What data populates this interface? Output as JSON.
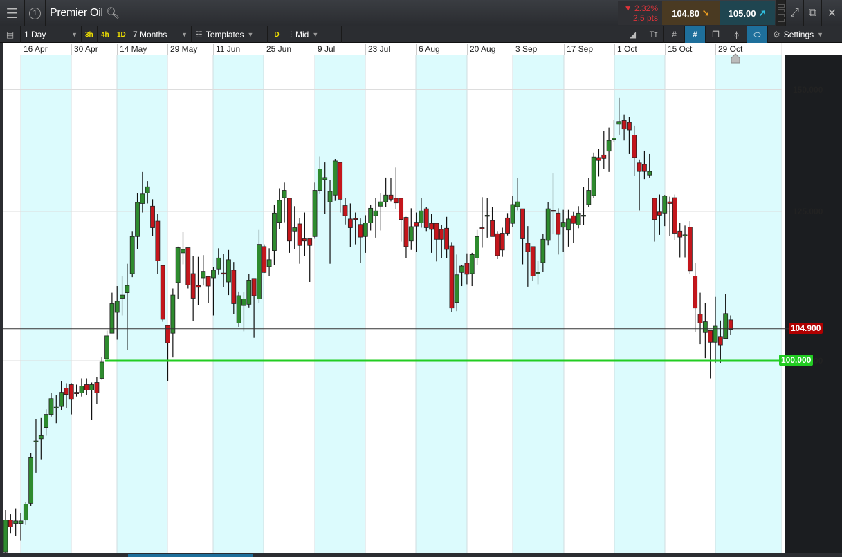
{
  "header": {
    "title": "Premier Oil",
    "window_number": "1",
    "change_pct": "2.32%",
    "change_pts": "2.5 pts",
    "sell": "104.80",
    "buy": "105.00"
  },
  "toolbar": {
    "interval": "1 Day",
    "quick": [
      "3h",
      "4h",
      "1D"
    ],
    "range": "7 Months",
    "templates": "Templates",
    "d_label": "D",
    "price_type": "Mid",
    "settings": "Settings"
  },
  "colors": {
    "up": "#2e8b2e",
    "down": "#c4161c",
    "band": "#dcfbfd",
    "level": "#22cc22",
    "last": "#b00000"
  },
  "chart_data": {
    "type": "candlestick",
    "scale": "log",
    "ylim": [
      75,
      158
    ],
    "x_ticks": [
      "16 Apr",
      "30 Apr",
      "14 May",
      "29 May",
      "11 Jun",
      "25 Jun",
      "9 Jul",
      "23 Jul",
      "6 Aug",
      "20 Aug",
      "3 Sep",
      "17 Sep",
      "1 Oct",
      "15 Oct",
      "29 Oct"
    ],
    "y_ticks": [
      "150.000",
      "125.000",
      "100.000"
    ],
    "last_price": "104.900",
    "level_line": "100.000",
    "ohlc": [
      [
        75.1,
        80,
        75,
        78.8
      ],
      [
        78.8,
        79.5,
        77.3,
        78.0
      ],
      [
        78.4,
        80.2,
        77,
        78.7
      ],
      [
        78.4,
        79.6,
        76.4,
        78.7
      ],
      [
        78.8,
        81,
        78.3,
        80.7
      ],
      [
        80.8,
        87.1,
        80.5,
        86.5
      ],
      [
        88.7,
        91.6,
        84.6,
        88.7
      ],
      [
        89,
        91.8,
        86.3,
        89.4
      ],
      [
        90.5,
        93,
        89.4,
        92.3
      ],
      [
        92.3,
        95.3,
        92,
        94.5
      ],
      [
        93.3,
        95,
        91.1,
        93.3
      ],
      [
        93.4,
        97,
        92.9,
        95.4
      ],
      [
        96,
        96.7,
        93.2,
        95.1
      ],
      [
        96.5,
        96.7,
        92.3,
        94.4
      ],
      [
        95.4,
        96.5,
        94.8,
        95.2
      ],
      [
        95.3,
        97.4,
        94.8,
        96.3
      ],
      [
        96.5,
        97.4,
        95,
        95.7
      ],
      [
        95.7,
        96.8,
        91.5,
        96.5
      ],
      [
        96.8,
        97.6,
        93.7,
        95.3
      ],
      [
        97.4,
        100.6,
        97.2,
        99.8
      ],
      [
        100.3,
        104.6,
        100,
        103.8
      ],
      [
        104.2,
        110.7,
        104.4,
        108.9
      ],
      [
        107.5,
        111.8,
        103.2,
        109.3
      ],
      [
        109.8,
        113.5,
        107,
        110.3
      ],
      [
        110.7,
        115.6,
        101.6,
        111.9
      ],
      [
        113.9,
        121.4,
        113.3,
        120.4
      ],
      [
        120.4,
        128.4,
        118.2,
        126.7
      ],
      [
        126.5,
        132.6,
        124.8,
        128.3
      ],
      [
        128.5,
        130.8,
        126.5,
        129.7
      ],
      [
        126,
        127.3,
        120.5,
        122
      ],
      [
        123.2,
        124.6,
        113.9,
        116.1
      ],
      [
        115.3,
        115.3,
        106,
        106.4
      ],
      [
        105.4,
        105.4,
        97,
        102.7
      ],
      [
        104.2,
        111.4,
        100.5,
        110.3
      ],
      [
        112.4,
        118.6,
        109.7,
        118.4
      ],
      [
        117.5,
        121.3,
        115.5,
        118.1
      ],
      [
        118.4,
        118.4,
        111.4,
        112
      ],
      [
        113.9,
        117,
        106.1,
        109.8
      ],
      [
        111.9,
        116.8,
        108.7,
        111.6
      ],
      [
        113.2,
        117.1,
        111.9,
        114.3
      ],
      [
        113.4,
        113.5,
        109,
        111.8
      ],
      [
        113.2,
        115,
        107,
        114.5
      ],
      [
        114.7,
        118.3,
        113.7,
        116.6
      ],
      [
        114,
        117.3,
        111.6,
        113.9
      ],
      [
        112.5,
        118,
        110.3,
        116.3
      ],
      [
        114.5,
        115.9,
        107.2,
        108.9
      ],
      [
        105.8,
        110.9,
        105.2,
        110.2
      ],
      [
        108.6,
        110.8,
        104.5,
        109.7
      ],
      [
        108.8,
        113.8,
        108.3,
        112.8
      ],
      [
        113.1,
        113.1,
        103.5,
        110.2
      ],
      [
        109.7,
        121.6,
        109,
        119
      ],
      [
        118.6,
        119,
        114,
        114.1
      ],
      [
        115.1,
        118.3,
        113.5,
        116.3
      ],
      [
        117.9,
        126.3,
        115.4,
        124.7
      ],
      [
        123,
        129.4,
        121.8,
        127.1
      ],
      [
        127.6,
        130.5,
        123,
        129
      ],
      [
        127.5,
        127.6,
        117.5,
        119.6
      ],
      [
        121.4,
        126,
        118.2,
        122
      ],
      [
        122.7,
        123.8,
        115.6,
        118.8
      ],
      [
        120,
        124.8,
        117,
        119.6
      ],
      [
        120,
        120,
        112.5,
        118.8
      ],
      [
        120.4,
        130.5,
        120,
        129
      ],
      [
        129,
        135.7,
        128.3,
        133.2
      ],
      [
        131.1,
        134.5,
        124.5,
        131.5
      ],
      [
        126.8,
        131,
        115.6,
        128.8
      ],
      [
        128.1,
        135.2,
        127,
        134.8
      ],
      [
        134.5,
        134.5,
        124.8,
        127.3
      ],
      [
        126.1,
        127.5,
        122.6,
        124.2
      ],
      [
        123.6,
        126.5,
        118.5,
        122
      ],
      [
        123.7,
        124.8,
        119,
        123.5
      ],
      [
        122.6,
        123.7,
        115.7,
        120.3
      ],
      [
        120.4,
        124.3,
        117.5,
        122.9
      ],
      [
        122.9,
        126.3,
        121.5,
        125.6
      ],
      [
        124.2,
        127.5,
        120.2,
        125.1
      ],
      [
        126,
        128.5,
        121.5,
        126.8
      ],
      [
        126.8,
        131.5,
        125.8,
        128.1
      ],
      [
        128.1,
        131.4,
        126.9,
        127.3
      ],
      [
        127.5,
        133.5,
        125.5,
        126.6
      ],
      [
        127.5,
        127.5,
        119.5,
        123.5
      ],
      [
        123.9,
        124,
        116.6,
        118.6
      ],
      [
        119.6,
        125.6,
        118,
        122.2
      ],
      [
        123,
        124.8,
        117.7,
        122.3
      ],
      [
        122.9,
        127.6,
        122,
        125.1
      ],
      [
        125.5,
        125.8,
        121.4,
        122
      ],
      [
        122.8,
        124.5,
        117.5,
        121.7
      ],
      [
        122.8,
        122.8,
        116,
        119.9
      ],
      [
        121.7,
        122.5,
        116.6,
        119.9
      ],
      [
        121.9,
        124,
        116.6,
        118.1
      ],
      [
        118.7,
        119.4,
        107.6,
        108.2
      ],
      [
        109.1,
        117.2,
        107.7,
        113.7
      ],
      [
        114.1,
        115.4,
        111.8,
        115.2
      ],
      [
        115.7,
        117.4,
        112.1,
        113.8
      ],
      [
        113.9,
        117.5,
        111.8,
        117.2
      ],
      [
        116.6,
        121.6,
        115.4,
        120.4
      ],
      [
        122,
        127.7,
        118.4,
        121.9
      ],
      [
        124.2,
        127.6,
        120.2,
        124.3
      ],
      [
        123.3,
        125.8,
        120.4,
        120.4
      ],
      [
        120.9,
        121.4,
        116.4,
        117
      ],
      [
        121,
        122,
        116.8,
        118
      ],
      [
        123.8,
        124.7,
        120.6,
        121
      ],
      [
        122.8,
        127.9,
        122.1,
        126.3
      ],
      [
        125.9,
        131.4,
        125.2,
        126.8
      ],
      [
        125.5,
        125.5,
        115.5,
        120
      ],
      [
        119.2,
        122.3,
        111.7,
        117.7
      ],
      [
        118.6,
        118.6,
        112.7,
        113.5
      ],
      [
        113.9,
        116.1,
        112.1,
        114.1
      ],
      [
        115.8,
        120.9,
        114.2,
        119.9
      ],
      [
        119.7,
        126.7,
        118.8,
        125.5
      ],
      [
        125.2,
        132.3,
        120.8,
        125.1
      ],
      [
        124.7,
        125.6,
        117.2,
        120.8
      ],
      [
        122.1,
        125.3,
        117.7,
        123
      ],
      [
        121.6,
        125.3,
        118.6,
        123.6
      ],
      [
        124.2,
        124.9,
        119.3,
        122.8
      ],
      [
        122.5,
        126,
        121.9,
        124.7
      ],
      [
        124.2,
        129.6,
        122.5,
        124.3
      ],
      [
        126.3,
        131.4,
        125.9,
        129
      ],
      [
        128,
        136.5,
        127.6,
        135.6
      ],
      [
        135.5,
        137.2,
        131.7,
        134.9
      ],
      [
        136,
        141,
        133.2,
        135.3
      ],
      [
        136.8,
        141.7,
        132.6,
        139
      ],
      [
        139.2,
        143.3,
        138.7,
        139.5
      ],
      [
        142.4,
        148.1,
        140.2,
        143
      ],
      [
        143.2,
        144.5,
        139,
        141.4
      ],
      [
        142.8,
        143.9,
        136.2,
        141.2
      ],
      [
        140.1,
        142.1,
        131.9,
        135.5
      ],
      [
        134.4,
        135.1,
        125.2,
        132.7
      ],
      [
        134.1,
        136.9,
        131.2,
        132.7
      ],
      [
        132,
        136.2,
        131.5,
        132.7
      ],
      [
        127.5,
        127.5,
        119.5,
        123.5
      ],
      [
        124.9,
        128.2,
        120.7,
        124.3
      ],
      [
        124.7,
        128.1,
        122.3,
        127.9
      ],
      [
        126.8,
        127.8,
        120.5,
        126.5
      ],
      [
        127.6,
        128.2,
        119.8,
        121
      ],
      [
        121.4,
        122.9,
        116.7,
        120.3
      ],
      [
        120.7,
        122.4,
        116.7,
        120.7
      ],
      [
        122.1,
        123.2,
        113.9,
        114.4
      ],
      [
        113.5,
        115.8,
        104.4,
        108.2
      ],
      [
        107.2,
        110.7,
        102.5,
        105.8
      ],
      [
        104.3,
        109,
        100.4,
        106
      ],
      [
        104.6,
        104.6,
        97.4,
        102.8
      ],
      [
        102.8,
        110,
        99.7,
        105.3
      ],
      [
        103.7,
        106.2,
        99.7,
        102.4
      ],
      [
        103.4,
        110.5,
        103.4,
        107.3
      ],
      [
        106.3,
        107,
        103.9,
        104.8
      ]
    ]
  }
}
